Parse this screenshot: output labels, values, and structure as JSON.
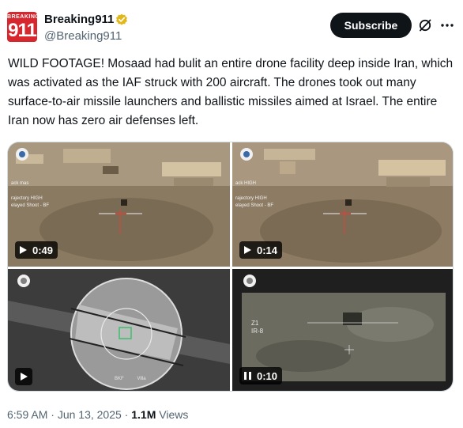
{
  "account": {
    "avatar_small_text": "BREAKING",
    "avatar_big_text": "911",
    "name": "Breaking911",
    "handle": "@Breaking911"
  },
  "header": {
    "subscribe_label": "Subscribe",
    "grok_icon": "grok-icon",
    "more_icon": "more-icon"
  },
  "tweet": {
    "text": "WILD FOOTAGE! Mosaad had bulit an entire drone facility deep inside Iran, which was activated as the IAF struck with 200 aircraft. The drones took out many surface-to-air missile launchers and ballistic missiles aimed at Israel. The entire Iran now has zero air defenses left."
  },
  "media": [
    {
      "duration": "0:49",
      "state_icon": "play-icon",
      "overlay": [
        "ack mas",
        "rajectory HIGH",
        "elayed Shoot - BF"
      ]
    },
    {
      "duration": "0:14",
      "state_icon": "play-icon",
      "overlay": [
        "ack HIGH",
        "rajectory HIGH",
        "elayed Shoot - BF"
      ]
    },
    {
      "duration": "",
      "state_icon": "play-icon",
      "overlay": [
        "BKF",
        "Villa"
      ]
    },
    {
      "duration": "0:10",
      "state_icon": "pause-icon",
      "overlay": [
        "Z1",
        "IR-8"
      ]
    }
  ],
  "footer": {
    "time": "6:59 AM",
    "separator": " · ",
    "date": "Jun 13, 2025",
    "views_count": "1.1M",
    "views_label": "Views"
  },
  "colors": {
    "accent": "#0f1419",
    "secondary_text": "#536471",
    "verified_gold": "#e2b719",
    "brand_red": "#d7262d"
  }
}
